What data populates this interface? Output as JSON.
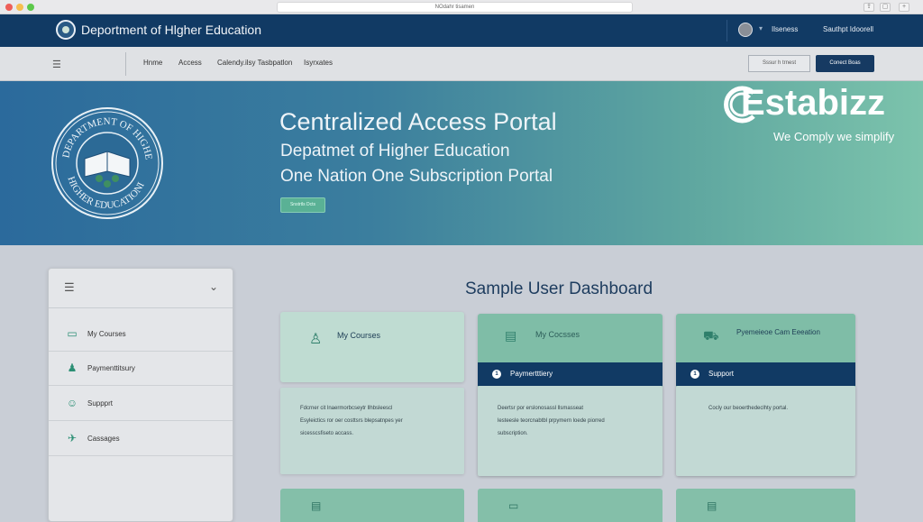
{
  "browser": {
    "url": "NOdahr tisamen"
  },
  "topbar": {
    "title": "Deportment of Hlgher Education",
    "user_name": "Ilseness",
    "sign_out": "Sauthpt Idoorell"
  },
  "nav": {
    "links": [
      "Hnme",
      "Access",
      "Calendy.ilsy Tasbpatlon",
      "Isyrxates"
    ],
    "ghost_button": "Sssur h trnest",
    "solid_button": "Conect Boas"
  },
  "hero": {
    "title": "Centralized Access Portal",
    "subtitle1": "Depatmet of Higher Education",
    "subtitle2": "One Nation One Subscription Portal",
    "button": "Snstrtls Dcts",
    "seal_text_top": "DEPARTMENT OF HIGHE",
    "seal_text_bottom": "HIGHER EDUCATIONI"
  },
  "brand": {
    "name": "Estabizz",
    "tagline": "We Comply we simplify"
  },
  "sidebar": {
    "items": [
      {
        "label": "My Courses",
        "icon": "laptop-icon"
      },
      {
        "label": "Paymenttitsury",
        "icon": "payment-icon"
      },
      {
        "label": "Suppprt",
        "icon": "support-icon"
      },
      {
        "label": "Cassages",
        "icon": "messages-icon"
      }
    ]
  },
  "dashboard": {
    "title": "Sample User Dashboard",
    "cards": [
      {
        "header": "My Courses",
        "icon": "user-icon",
        "band_label": "",
        "band_number": "",
        "body": [
          "Fdcrner cit lnaermorbcseytr llhbsleescl",
          "Esyleictics ror oer costtsrs blepsatnpes yer",
          "sicesscsfiseto accass."
        ]
      },
      {
        "header": "My Cocsses",
        "icon": "clipboard-icon",
        "band_label": "Paymertttiery",
        "band_number": "1",
        "body": [
          "Deertsr por erslonosassl llsmasseat",
          "lesteesle teorcnabtbl prpymern loede piorred",
          "subscription."
        ]
      },
      {
        "header": "Pyemeieoe Cam Eeeation",
        "icon": "truck-icon",
        "band_label": "Support",
        "band_number": "1",
        "body": [
          "Cocly our beoerthedeclhty portal."
        ]
      }
    ]
  },
  "colors": {
    "navy": "#113a64",
    "teal": "#7fbda7",
    "hero_start": "#2b6a9c",
    "hero_end": "#7cc3ac"
  }
}
